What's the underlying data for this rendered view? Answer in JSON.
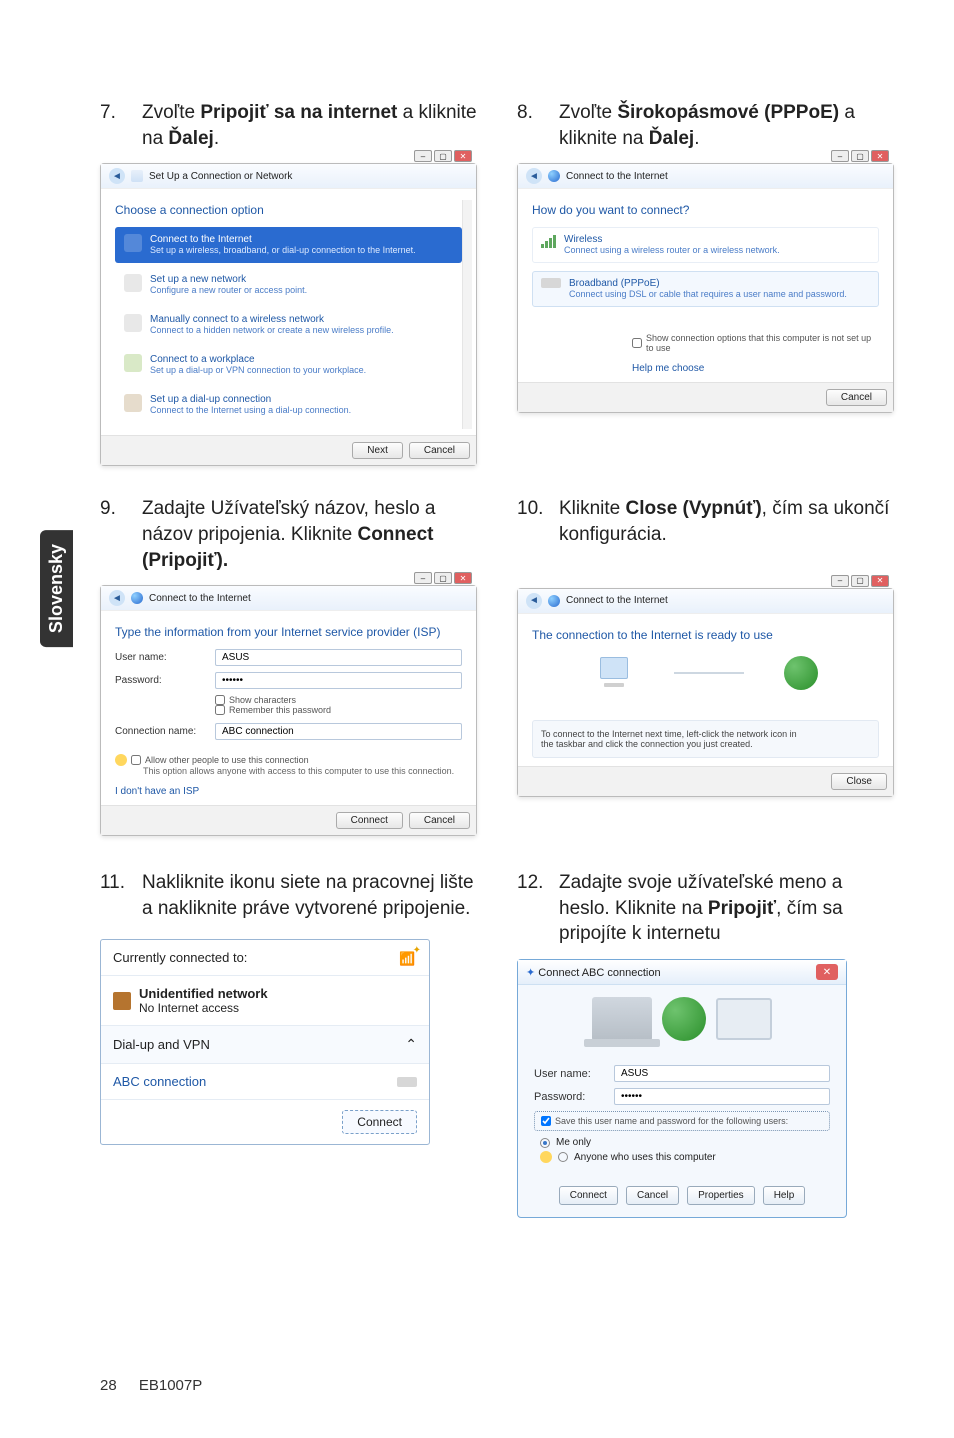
{
  "sideTab": "Slovensky",
  "pageNumber": "28",
  "model": "EB1007P",
  "steps": {
    "s7": {
      "num": "7.",
      "text_a": "Zvoľte ",
      "bold_a": "Pripojiť sa na internet",
      "text_b": " a kliknite na ",
      "bold_b": "Ďalej",
      "text_c": "."
    },
    "s8": {
      "num": "8.",
      "text_a": "Zvoľte ",
      "bold_a": "Širokopásmové (PPPoE)",
      "text_b": "  a kliknite na ",
      "bold_b": "Ďalej",
      "text_c": "."
    },
    "s9": {
      "num": "9.",
      "text": "Zadajte Užívateľský názov, heslo a názov pripojenia. Kliknite ",
      "bold": "Connect (Pripojiť)."
    },
    "s10": {
      "num": "10.",
      "text_a": "Kliknite ",
      "bold": "Close (Vypnúť)",
      "text_b": ", čím sa ukončí konfigurácia."
    },
    "s11": {
      "num": "11.",
      "text": "Nakliknite ikonu siete na pracovnej lište a nakliknite práve vytvorené pripojenie."
    },
    "s12": {
      "num": "12.",
      "text_a": "Zadajte svoje užívateľské meno a heslo. Kliknite na ",
      "bold": "Pripojiť",
      "text_b": ", čím sa pripojíte k internetu"
    }
  },
  "dlg7": {
    "title": "Set Up a Connection or Network",
    "heading": "Choose a connection option",
    "options": [
      {
        "main": "Connect to the Internet",
        "sub": "Set up a wireless, broadband, or dial-up connection to the Internet."
      },
      {
        "main": "Set up a new network",
        "sub": "Configure a new router or access point."
      },
      {
        "main": "Manually connect to a wireless network",
        "sub": "Connect to a hidden network or create a new wireless profile."
      },
      {
        "main": "Connect to a workplace",
        "sub": "Set up a dial-up or VPN connection to your workplace."
      },
      {
        "main": "Set up a dial-up connection",
        "sub": "Connect to the Internet using a dial-up connection."
      }
    ],
    "next": "Next",
    "cancel": "Cancel"
  },
  "dlg8": {
    "title": "Connect to the Internet",
    "heading": "How do you want to connect?",
    "wireless": {
      "main": "Wireless",
      "sub": "Connect using a wireless router or a wireless network."
    },
    "broadband": {
      "main": "Broadband (PPPoE)",
      "sub": "Connect using DSL or cable that requires a user name and password."
    },
    "showopts": "Show connection options that this computer is not set up to use",
    "help": "Help me choose",
    "cancel": "Cancel"
  },
  "dlg9": {
    "title": "Connect to the Internet",
    "heading": "Type the information from your Internet service provider (ISP)",
    "userLabel": "User name:",
    "userVal": "ASUS",
    "passLabel": "Password:",
    "passVal": "••••••",
    "showChars": "Show characters",
    "remember": "Remember this password",
    "connNameLabel": "Connection name:",
    "connNameVal": "ABC connection",
    "allow": "Allow other people to use this connection",
    "allowSub": "This option allows anyone with access to this computer to use this connection.",
    "noIsp": "I don't have an ISP",
    "connect": "Connect",
    "cancel": "Cancel"
  },
  "dlg10": {
    "title": "Connect to the Internet",
    "heading": "The connection to the Internet is ready to use",
    "tip1": "To connect to the Internet next time, left-click the network icon in",
    "tip2": "the taskbar and click the connection you just created.",
    "close": "Close"
  },
  "tray11": {
    "currently": "Currently connected to:",
    "unidentified": "Unidentified network",
    "noaccess": "No Internet access",
    "dialup": "Dial-up and VPN",
    "abc": "ABC connection",
    "connect": "Connect"
  },
  "dial12": {
    "title": "Connect ABC connection",
    "userLabel": "User name:",
    "userVal": "ASUS",
    "passLabel": "Password:",
    "passVal": "••••••",
    "saveLine": "Save this user name and password for the following users:",
    "meOnly": "Me only",
    "anyone": "Anyone who uses this computer",
    "connect": "Connect",
    "cancel": "Cancel",
    "properties": "Properties",
    "help": "Help"
  }
}
